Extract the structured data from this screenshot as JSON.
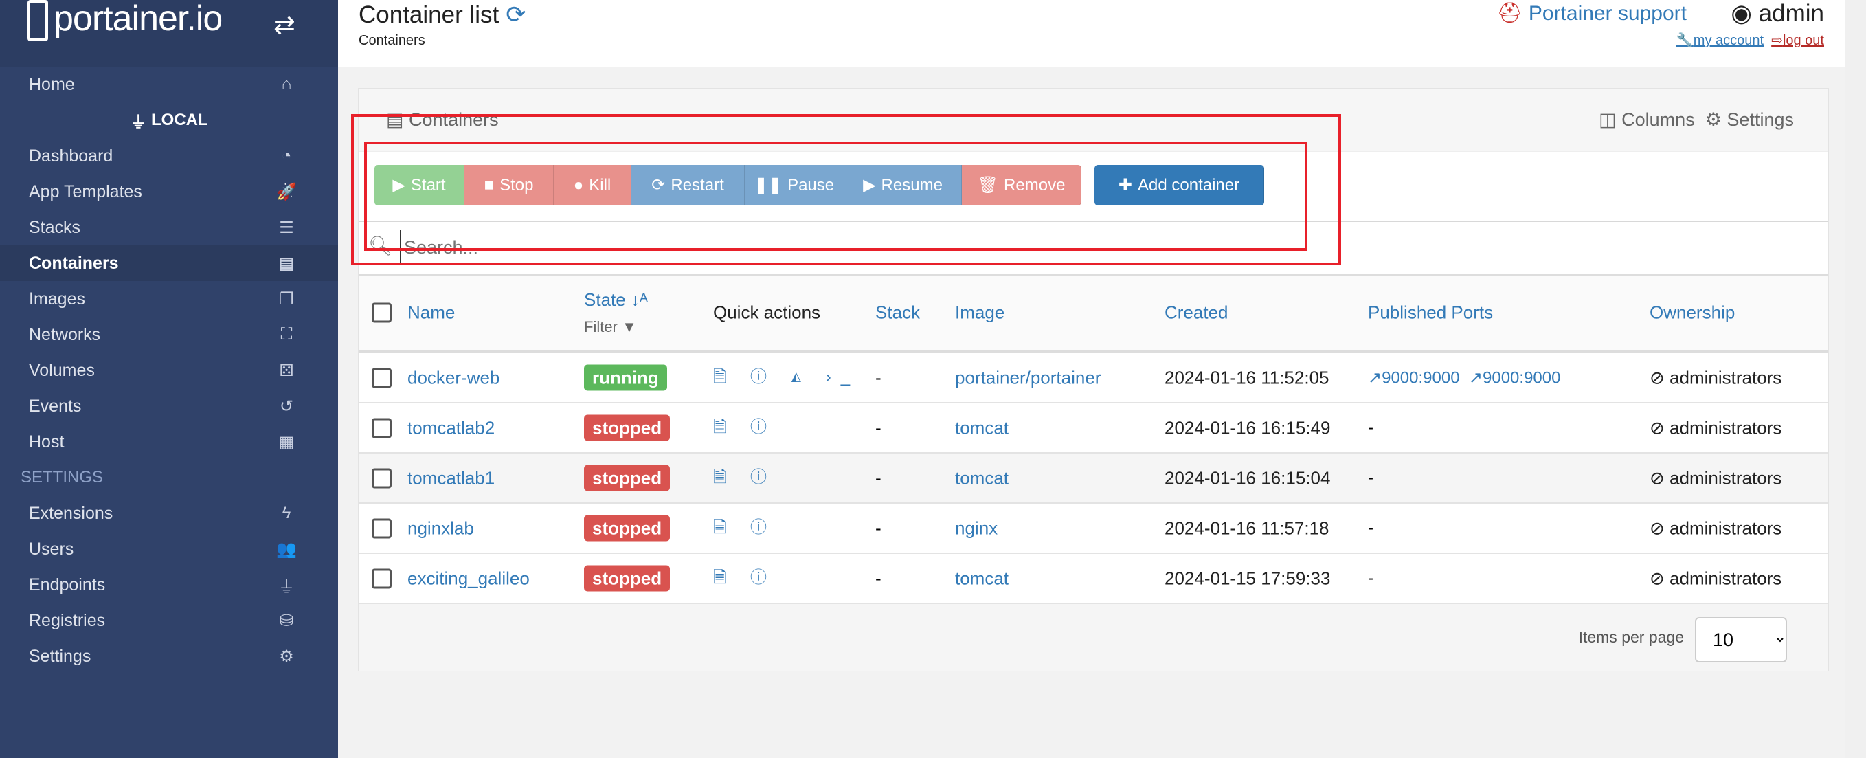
{
  "sidebar": {
    "brand": "portainer.io",
    "endpoint": "LOCAL",
    "settings_header": "SETTINGS",
    "items": [
      {
        "label": "Home",
        "icon": "home-icon",
        "glyph": "⌂"
      },
      {
        "label": "Dashboard",
        "icon": "tachometer-icon",
        "glyph": "◔"
      },
      {
        "label": "App Templates",
        "icon": "rocket-icon",
        "glyph": "🚀"
      },
      {
        "label": "Stacks",
        "icon": "th-list-icon",
        "glyph": "☰"
      },
      {
        "label": "Containers",
        "icon": "server-icon",
        "glyph": "▤",
        "active": true
      },
      {
        "label": "Images",
        "icon": "clone-icon",
        "glyph": "❐"
      },
      {
        "label": "Networks",
        "icon": "sitemap-icon",
        "glyph": "⛶"
      },
      {
        "label": "Volumes",
        "icon": "cubes-icon",
        "glyph": "⚄"
      },
      {
        "label": "Events",
        "icon": "history-icon",
        "glyph": "↺"
      },
      {
        "label": "Host",
        "icon": "th-icon",
        "glyph": "▦"
      }
    ],
    "settings_items": [
      {
        "label": "Extensions",
        "icon": "bolt-icon",
        "glyph": "ϟ"
      },
      {
        "label": "Users",
        "icon": "users-icon",
        "glyph": "👥"
      },
      {
        "label": "Endpoints",
        "icon": "plug-icon",
        "glyph": "⏚"
      },
      {
        "label": "Registries",
        "icon": "database-icon",
        "glyph": "⛁"
      },
      {
        "label": "Settings",
        "icon": "cogs-icon",
        "glyph": "⚙"
      }
    ]
  },
  "header": {
    "title": "Container list",
    "breadcrumb": "Containers",
    "support": "Portainer support",
    "user": "admin",
    "my_account": "my account",
    "log_out": "log out"
  },
  "panel": {
    "title": "Containers",
    "columns": "Columns",
    "settings": "Settings"
  },
  "actions": [
    {
      "label": "Start",
      "glyph": "▶",
      "color": "#94d194"
    },
    {
      "label": "Stop",
      "glyph": "■",
      "color": "#e8918c"
    },
    {
      "label": "Kill",
      "glyph": "●",
      "color": "#e8918c"
    },
    {
      "label": "Restart",
      "glyph": "⟳",
      "color": "#7aa7d0"
    },
    {
      "label": "Pause",
      "glyph": "❚❚",
      "color": "#7aa7d0"
    },
    {
      "label": "Resume",
      "glyph": "▶",
      "color": "#7aa7d0"
    },
    {
      "label": "Remove",
      "glyph": "🗑",
      "color": "#e8918c"
    }
  ],
  "add_container": "Add container",
  "search": {
    "placeholder": "Search..."
  },
  "table": {
    "headers": {
      "name": "Name",
      "state": "State",
      "filter": "Filter",
      "quick": "Quick actions",
      "stack": "Stack",
      "image": "Image",
      "created": "Created",
      "ports": "Published Ports",
      "ownership": "Ownership"
    },
    "rows": [
      {
        "name": "docker-web",
        "state": "running",
        "quick": "🗎 ⓘ ◭ ›_",
        "stack": "-",
        "image": "portainer/portainer",
        "created": "2024-01-16 11:52:05",
        "ports": [
          "9000:9000",
          "9000:9000"
        ],
        "ownership": "administrators"
      },
      {
        "name": "tomcatlab2",
        "state": "stopped",
        "quick": "🗎 ⓘ",
        "stack": "-",
        "image": "tomcat",
        "created": "2024-01-16 16:15:49",
        "ports": [],
        "ports_text": "-",
        "ownership": "administrators"
      },
      {
        "name": "tomcatlab1",
        "state": "stopped",
        "quick": "🗎 ⓘ",
        "stack": "-",
        "image": "tomcat",
        "created": "2024-01-16 16:15:04",
        "ports": [],
        "ports_text": "-",
        "ownership": "administrators"
      },
      {
        "name": "nginxlab",
        "state": "stopped",
        "quick": "🗎 ⓘ",
        "stack": "-",
        "image": "nginx",
        "created": "2024-01-16 11:57:18",
        "ports": [],
        "ports_text": "-",
        "ownership": "administrators"
      },
      {
        "name": "exciting_galileo",
        "state": "stopped",
        "quick": "🗎 ⓘ",
        "stack": "-",
        "image": "tomcat",
        "created": "2024-01-15 17:59:33",
        "ports": [],
        "ports_text": "-",
        "ownership": "administrators"
      }
    ]
  },
  "pagination": {
    "label": "Items per page",
    "value": "10"
  },
  "colors": {
    "sidebar": "#30426a",
    "running": "#5cb85c",
    "stopped": "#d9534f",
    "link": "#337ab7",
    "add": "#337ab7",
    "highlight_box": "#e8202a"
  }
}
